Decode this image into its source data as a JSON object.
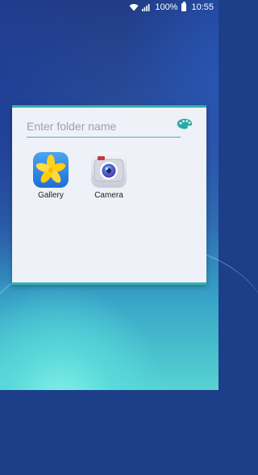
{
  "status_bar": {
    "battery": "100%",
    "time": "10:55",
    "icons": [
      "wifi-icon",
      "signal-icon",
      "battery-icon"
    ]
  },
  "folder": {
    "name_placeholder": "Enter folder name",
    "name_value": "",
    "palette_icon": "palette-icon",
    "accent_color": "#33b2ad",
    "apps": [
      {
        "label": "Gallery",
        "icon": "gallery-icon"
      },
      {
        "label": "Camera",
        "icon": "camera-icon"
      }
    ]
  }
}
